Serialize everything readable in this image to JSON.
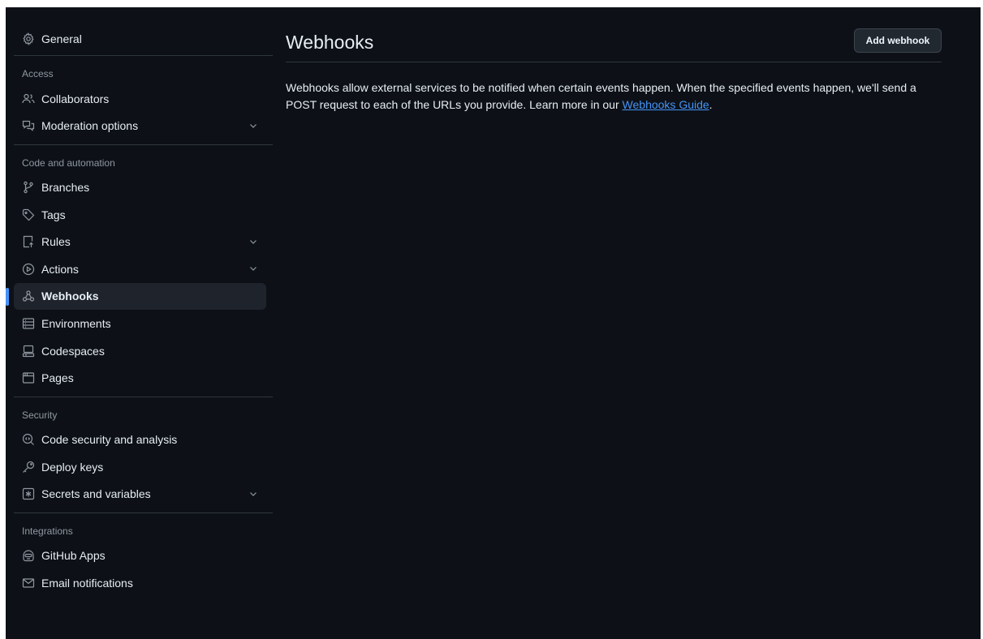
{
  "sidebar": {
    "general": {
      "label": "General",
      "icon": "gear-icon"
    },
    "sections": [
      {
        "title": "Access",
        "items": [
          {
            "label": "Collaborators",
            "icon": "people-icon",
            "expandable": false
          },
          {
            "label": "Moderation options",
            "icon": "comment-discussion-icon",
            "expandable": true
          }
        ]
      },
      {
        "title": "Code and automation",
        "items": [
          {
            "label": "Branches",
            "icon": "git-branch-icon",
            "expandable": false
          },
          {
            "label": "Tags",
            "icon": "tag-icon",
            "expandable": false
          },
          {
            "label": "Rules",
            "icon": "repo-push-icon",
            "expandable": true
          },
          {
            "label": "Actions",
            "icon": "play-icon",
            "expandable": true
          },
          {
            "label": "Webhooks",
            "icon": "webhook-icon",
            "expandable": false,
            "active": true
          },
          {
            "label": "Environments",
            "icon": "server-icon",
            "expandable": false
          },
          {
            "label": "Codespaces",
            "icon": "codespaces-icon",
            "expandable": false
          },
          {
            "label": "Pages",
            "icon": "browser-icon",
            "expandable": false
          }
        ]
      },
      {
        "title": "Security",
        "items": [
          {
            "label": "Code security and analysis",
            "icon": "codescan-icon",
            "expandable": false
          },
          {
            "label": "Deploy keys",
            "icon": "key-icon",
            "expandable": false
          },
          {
            "label": "Secrets and variables",
            "icon": "asterisk-icon",
            "expandable": true
          }
        ]
      },
      {
        "title": "Integrations",
        "items": [
          {
            "label": "GitHub Apps",
            "icon": "hubot-icon",
            "expandable": false
          },
          {
            "label": "Email notifications",
            "icon": "mail-icon",
            "expandable": false
          }
        ]
      }
    ]
  },
  "main": {
    "title": "Webhooks",
    "add_button": "Add webhook",
    "description_prefix": "Webhooks allow external services to be notified when certain events happen. When the specified events happen, we'll send a POST request to each of the URLs you provide. Learn more in our ",
    "guide_link": "Webhooks Guide",
    "description_suffix": "."
  },
  "colors": {
    "background": "#0d1117",
    "accent": "#4493f8",
    "border": "#30363d",
    "muted": "#9198a1"
  }
}
